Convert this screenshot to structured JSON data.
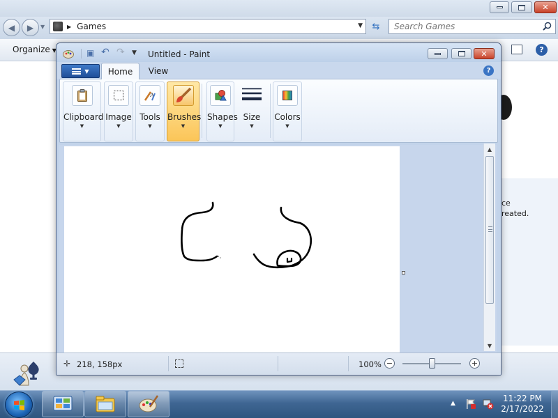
{
  "explorer": {
    "address_path": "Games",
    "search_placeholder": "Search Games",
    "organize_label": "Organize",
    "details_line1": "ce",
    "details_line2": "reated."
  },
  "paint": {
    "title": "Untitled - Paint",
    "tabs": [
      {
        "label": "Home",
        "active": true
      },
      {
        "label": "View",
        "active": false
      }
    ],
    "ribbon_groups": [
      {
        "label": "Clipboard",
        "icon": "clipboard-icon"
      },
      {
        "label": "Image",
        "icon": "image-select-icon"
      },
      {
        "label": "Tools",
        "icon": "tools-icon"
      },
      {
        "label": "Brushes",
        "icon": "brush-icon",
        "active": true
      },
      {
        "label": "Shapes",
        "icon": "shapes-icon"
      },
      {
        "label": "Size",
        "icon": "size-icon"
      },
      {
        "label": "Colors",
        "icon": "colors-icon"
      }
    ],
    "status": {
      "cursor_position": "218, 158px",
      "zoom": "100%",
      "zoom_level_percent": 100
    }
  },
  "taskbar": {
    "time": "11:22 PM",
    "date": "2/17/2022",
    "pinned": [
      "control-panel-icon",
      "explorer-icon",
      "paint-icon"
    ]
  },
  "colors": {
    "accent": "#3a74c4",
    "active_ribbon_group": "#fbc558",
    "canvas_background": "#ffffff",
    "drawing_stroke": "#000000"
  }
}
